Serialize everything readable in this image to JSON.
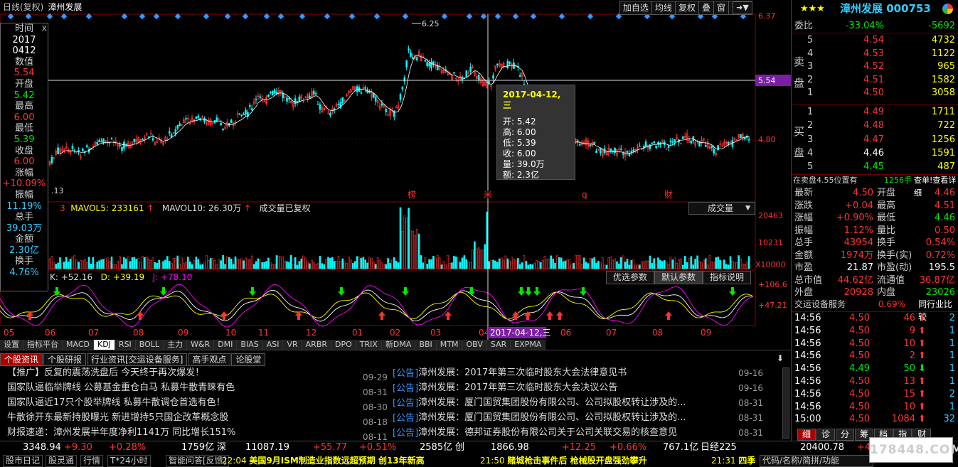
{
  "title_bar": {
    "period": "日线(复权)",
    "stock_name": "漳州发展"
  },
  "chart_toolbar": [
    "加自选",
    "均线",
    "复权",
    "叠",
    "窗",
    "预测"
  ],
  "price_axis": [
    "6.37",
    "5.54",
    "4.80"
  ],
  "price_highlight": "5.54",
  "peak_label": "6.25",
  "low_label": ".13",
  "chart_markers": [
    "榜",
    "米",
    "q",
    "财"
  ],
  "info_panel": {
    "close_glyph": "X",
    "time_label": "时间",
    "year": "2017",
    "date": "0412",
    "value_label": "数值",
    "value": "5.54",
    "open_label": "开盘",
    "open": "5.42",
    "high_label": "最高",
    "high": "6.00",
    "low_label": "最低",
    "low": "5.39",
    "close_label": "收盘",
    "close": "6.00",
    "chg_label": "涨幅",
    "chg": "+10.09%",
    "amp_label": "振幅",
    "amp": "11.19%",
    "vol_label": "总手",
    "vol": "39.03万",
    "amt_label": "金额",
    "amt": "2.30亿",
    "turn_label": "换手",
    "turn": "4.76%"
  },
  "tooltip": {
    "date": "2017-04-12,三",
    "open": "开: 5.42",
    "high": "高: 6.00",
    "low": "低: 5.39",
    "close": "收: 6.00",
    "vol": "量: 39.0万",
    "amt": "额: 2.3亿"
  },
  "volume": {
    "legend_prefix": "3",
    "mavol5": "MAVOL5: 233161",
    "mavol10": "MAVOL10: 26.30万",
    "note": "成交量已复权",
    "selector": "成交量",
    "axis": [
      "20463",
      "10231",
      "X10000"
    ]
  },
  "kdj": {
    "k": "K: +52.16",
    "d": "D: +39.19",
    "j": "J: +78.10",
    "axis": [
      "+106.6",
      "+47.21"
    ],
    "params": [
      "优选参数",
      "默认参数",
      "指标说明"
    ]
  },
  "x_axis": [
    "05",
    "06",
    "07",
    "08",
    "09",
    "10",
    "11",
    "12",
    "01",
    "02",
    "03",
    "04",
    "06",
    "07",
    "08",
    "09"
  ],
  "x_highlight": "2017-04-12,三",
  "indicator_tabs": [
    "设置",
    "指标平台",
    "MACD",
    "KDJ",
    "RSI",
    "BOLL",
    "主力",
    "W&R",
    "DMI",
    "BIAS",
    "ASI",
    "VR",
    "ARBR",
    "DPO",
    "TRIX",
    "新DMA",
    "BBI",
    "MTM",
    "OBV",
    "SAR",
    "EXPMA"
  ],
  "news_tabs": [
    "个股资讯",
    "个股研报",
    "行业资讯[交运设备服务]",
    "高手观点",
    "论股堂"
  ],
  "news_left": [
    {
      "title": "【推广】反复的震荡洗盘后 今天终于再次爆发！",
      "date": "09-29"
    },
    {
      "title": "国家队逼临举牌线 公募基金重仓白马 私募牛散青睐有色",
      "date": "08-31"
    },
    {
      "title": "国家队逼近17只个股举牌线 私募牛散调仓首选有色！",
      "date": "08-30"
    },
    {
      "title": "牛散徐开东最新持股曝光 新进增持5只国企改革概念股",
      "date": "08-18"
    },
    {
      "title": "财报速递：漳州发展半年度净利1141万 同比增长151%",
      "date": "08-11"
    }
  ],
  "news_right": [
    {
      "tag": "[公告]",
      "title": "漳州发展：2017年第三次临时股东大会法律意见书",
      "date": "09-16"
    },
    {
      "tag": "[公告]",
      "title": "漳州发展：2017年第三次临时股东大会决议公告",
      "date": "09-16"
    },
    {
      "tag": "[公告]",
      "title": "漳州发展：厦门国贸集团股份有限公司、公司拟股权转让涉及的...",
      "date": "08-31"
    },
    {
      "tag": "[公告]",
      "title": "漳州发展：厦门国贸集团股份有限公司、公司拟股权转让涉及的...",
      "date": "08-31"
    },
    {
      "tag": "[公告]",
      "title": "漳州发展：德邦证券股份有限公司关于公司关联交易的核查意见",
      "date": "08-31"
    }
  ],
  "right_panel": {
    "stars": "★★★",
    "name_code": "漳州发展 000753",
    "weibi_label": "委比",
    "weibi": "-33.04%",
    "weicha": "-5692",
    "sell_label": "卖盘",
    "buy_label": "买盘",
    "asks": [
      {
        "lvl": "5",
        "price": "4.54",
        "vol": "4732"
      },
      {
        "lvl": "4",
        "price": "4.53",
        "vol": "1122"
      },
      {
        "lvl": "3",
        "price": "4.52",
        "vol": "965"
      },
      {
        "lvl": "2",
        "price": "4.51",
        "vol": "1582"
      },
      {
        "lvl": "1",
        "price": "4.50",
        "vol": "3058"
      }
    ],
    "bids": [
      {
        "lvl": "1",
        "price": "4.49",
        "vol": "1711"
      },
      {
        "lvl": "2",
        "price": "4.48",
        "vol": "722"
      },
      {
        "lvl": "3",
        "price": "4.47",
        "vol": "1256"
      },
      {
        "lvl": "4",
        "price": "4.46",
        "vol": "1591"
      },
      {
        "lvl": "5",
        "price": "4.45",
        "vol": "487"
      }
    ],
    "order_note": "在卖盘4.55位置有",
    "order_vol": "1256手",
    "order_link": "查单!查看详细",
    "stats": [
      [
        "最新",
        "4.50",
        "开盘",
        "4.46"
      ],
      [
        "涨跌",
        "+0.04",
        "最高",
        "4.51"
      ],
      [
        "涨幅",
        "+0.90%",
        "最低",
        "4.46"
      ],
      [
        "振幅",
        "1.12%",
        "量比",
        "0.50"
      ],
      [
        "总手",
        "43954",
        "换手",
        "0.54%"
      ],
      [
        "金额",
        "1974万",
        "换手(实)",
        "0.72%"
      ],
      [
        "市盈",
        "21.87",
        "市盈(动)",
        "195.5"
      ],
      [
        "总市值",
        "44.62亿",
        "流通值",
        "36.87亿"
      ],
      [
        "外盘",
        "20928",
        "内盘",
        "23026"
      ]
    ],
    "industry": "交运设备服务",
    "industry_chg": "0.69%",
    "industry_btn": "同行业比较",
    "ticks": [
      {
        "time": "14:56",
        "price": "4.50",
        "vol": "46",
        "dir": "up",
        "n": "2"
      },
      {
        "time": "14:56",
        "price": "4.50",
        "vol": "9",
        "dir": "up",
        "n": "1"
      },
      {
        "time": "14:56",
        "price": "4.50",
        "vol": "10",
        "dir": "up",
        "n": "1"
      },
      {
        "time": "14:56",
        "price": "4.50",
        "vol": "2",
        "dir": "up",
        "n": "1"
      },
      {
        "time": "14:56",
        "price": "4.49",
        "vol": "50",
        "dir": "down",
        "n": "1"
      },
      {
        "time": "14:56",
        "price": "4.50",
        "vol": "13",
        "dir": "up",
        "n": "1"
      },
      {
        "time": "14:56",
        "price": "4.50",
        "vol": "15",
        "dir": "up",
        "n": "2"
      },
      {
        "time": "14:56",
        "price": "4.50",
        "vol": "10",
        "dir": "up",
        "n": "1"
      },
      {
        "time": "15:00",
        "price": "4.50",
        "vol": "1084",
        "dir": "up",
        "n": "32"
      }
    ],
    "bottom_tabs": [
      "细",
      "诊",
      "分",
      "筹",
      "档",
      "指",
      "财"
    ]
  },
  "indices": [
    {
      "value": "3348.94",
      "chg": "+9.30",
      "pct": "+0.28%",
      "amt": "1759亿",
      "name": "深"
    },
    {
      "value": "11087.19",
      "chg": "+55.77",
      "pct": "+0.51%",
      "amt": "2585亿",
      "name": "创"
    },
    {
      "value": "1866.98",
      "chg": "+12.25",
      "pct": "+0.66%",
      "amt": "767.1亿",
      "name": "日经225"
    },
    {
      "value": "20400.78",
      "chg": "+44.50",
      "pct": "",
      "amt": "",
      "name": ""
    }
  ],
  "status_items": [
    "股市日记",
    "股灵通",
    "行情",
    "T*24小时",
    "智能问答[反馈]"
  ],
  "ticker": [
    {
      "time": "22:04",
      "text": "美国9月ISM制造业指数远超预期 创13年新高"
    },
    {
      "time": "21:50",
      "text": "赌城枪击事件后 枪械股开盘强劲攀升"
    },
    {
      "time": "21:31",
      "text": "四季"
    }
  ],
  "search_hint": "代码/名称/简拼/功能",
  "watermark": "178448.COM",
  "colors": {
    "up": "#ff3232",
    "down": "#00ffff",
    "accent": "#3399ff",
    "highlight": "#7a1fa2"
  }
}
